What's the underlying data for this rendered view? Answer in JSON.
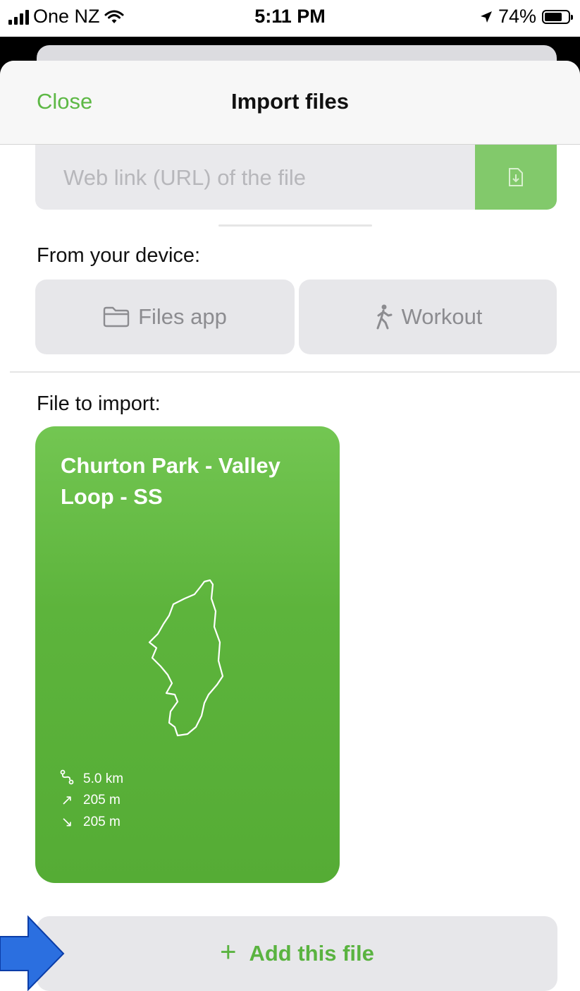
{
  "status_bar": {
    "carrier": "One NZ",
    "time": "5:11 PM",
    "battery_percent_label": "74%",
    "battery_level": 0.74,
    "icons": [
      "signal-icon",
      "wifi-icon",
      "location-arrow-icon",
      "battery-icon"
    ]
  },
  "nav": {
    "close_label": "Close",
    "title": "Import files"
  },
  "url_input": {
    "placeholder": "Web link (URL) of the file",
    "value": "",
    "button_icon": "file-download-icon"
  },
  "device_section": {
    "label": "From your device:",
    "files_app_label": "Files app",
    "workout_label": "Workout"
  },
  "file_section": {
    "label": "File to import:",
    "card": {
      "title": "Churton Park - Valley Loop - SS",
      "distance": "5.0 km",
      "ascent": "205 m",
      "descent": "205 m"
    }
  },
  "add_button": {
    "label": "Add this file",
    "icon": "plus-icon"
  },
  "colors": {
    "accent": "#5db845",
    "card_green": "#5db43c",
    "url_button_green": "#82c96b",
    "arrow_blue": "#2b6fe0"
  }
}
